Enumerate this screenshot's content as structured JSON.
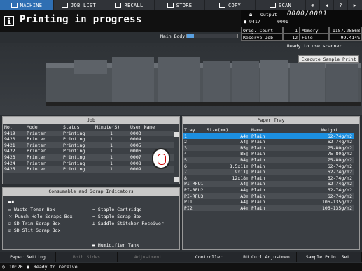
{
  "tabs": [
    {
      "label": "MACHINE",
      "icon": "machine-icon",
      "active": true
    },
    {
      "label": "JOB LIST",
      "icon": "job-list-icon",
      "active": false
    },
    {
      "label": "RECALL",
      "icon": "recall-icon",
      "active": false
    },
    {
      "label": "STORE",
      "icon": "store-icon",
      "active": false
    },
    {
      "label": "COPY",
      "icon": "copy-icon",
      "active": false
    },
    {
      "label": "SCAN",
      "icon": "scan-icon",
      "active": false
    }
  ],
  "header": {
    "info_glyph": "i",
    "title": "Printing in progress",
    "main_body_label": "Main Body",
    "main_body_progress": 0.14
  },
  "output_panel": {
    "output_label": "Output",
    "output_value": "0000/0001",
    "job_number": "9417",
    "job_count": "0001"
  },
  "stats": {
    "orig_count_label": "Orig. Count",
    "orig_count_value": "1",
    "memory_label": "Memory",
    "memory_value": "1187.2556B",
    "reserve_job_label": "Reserve Job",
    "reserve_job_value": "12",
    "file_amount_label": "File Amount",
    "file_amount_value": "99.414%"
  },
  "status_ready_scanner": "Ready to use scanner",
  "execute_sample_print": "Execute Sample Print",
  "job_panel": {
    "title": "Job",
    "columns": [
      "No.",
      "Mode",
      "Status",
      "Minute(S)",
      "User Name"
    ],
    "rows": [
      [
        "9419",
        "Printer",
        "Printing",
        "1",
        "0003"
      ],
      [
        "9420",
        "Printer",
        "Printing",
        "1",
        "0004"
      ],
      [
        "9421",
        "Printer",
        "Printing",
        "1",
        "0005"
      ],
      [
        "9422",
        "Printer",
        "Printing",
        "1",
        "0006"
      ],
      [
        "9423",
        "Printer",
        "Printing",
        "1",
        "0007"
      ],
      [
        "9424",
        "Printer",
        "Printing",
        "1",
        "0008"
      ],
      [
        "9425",
        "Printer",
        "Printing",
        "1",
        "0009"
      ]
    ]
  },
  "paper_tray": {
    "title": "Paper Tray",
    "columns": [
      "Tray",
      "Size(mm)",
      "Name",
      "Weight"
    ],
    "rows": [
      [
        "1",
        "A4▯",
        "Plain",
        "62-74g/m2"
      ],
      [
        "2",
        "A4▯",
        "Plain",
        "62-74g/m2"
      ],
      [
        "3",
        "B5▯",
        "Plain",
        "75-80g/m2"
      ],
      [
        "4",
        "B5▯",
        "Plain",
        "75-80g/m2"
      ],
      [
        "5",
        "B4▯",
        "Plain",
        "75-80g/m2"
      ],
      [
        "6",
        "8.5x11▯",
        "Plain",
        "62-74g/m2"
      ],
      [
        "7",
        "9x11▯",
        "Plain",
        "62-74g/m2"
      ],
      [
        "8",
        "12x18▯",
        "Plain",
        "62-74g/m2"
      ],
      [
        "PI-RFU1",
        "A4▯",
        "Plain",
        "62-74g/m2"
      ],
      [
        "PI-RFU2",
        "A4▯",
        "Plain",
        "62-74g/m2"
      ],
      [
        "PI-RFU3",
        "A3▯",
        "Plain",
        "62-74g/m2"
      ],
      [
        "PI1",
        "A4▯",
        "Plain",
        "106-135g/m2"
      ],
      [
        "PI2",
        "A4▯",
        "Plain",
        "106-135g/m2"
      ]
    ]
  },
  "consumables": {
    "title": "Consumable and Scrap Indicators",
    "left": [
      "Waste Toner Box",
      "Punch-Hole Scraps Box",
      "SD Trim Scrap Box",
      "SD Slit Scrap Box"
    ],
    "right": [
      "Staple Cartridge",
      "Staple Scrap Box",
      "Saddle Stitcher Receiver"
    ],
    "bottom": "Humidifier Tank"
  },
  "bottom_buttons": [
    {
      "label": "Paper Setting",
      "enabled": true
    },
    {
      "label": "Both Sides",
      "enabled": false
    },
    {
      "label": "Adjustment",
      "enabled": false
    },
    {
      "label": "Controller",
      "enabled": true
    },
    {
      "label": "RU Curl Adjustment",
      "enabled": true
    },
    {
      "label": "Sample Print Set.",
      "enabled": true
    }
  ],
  "status": {
    "time": "10:20",
    "message": "Ready to receive"
  },
  "colors": {
    "active_tab": "#2f6fb3",
    "selected_row": "#1c8fe0",
    "panel_bg": "#3a3e43"
  }
}
